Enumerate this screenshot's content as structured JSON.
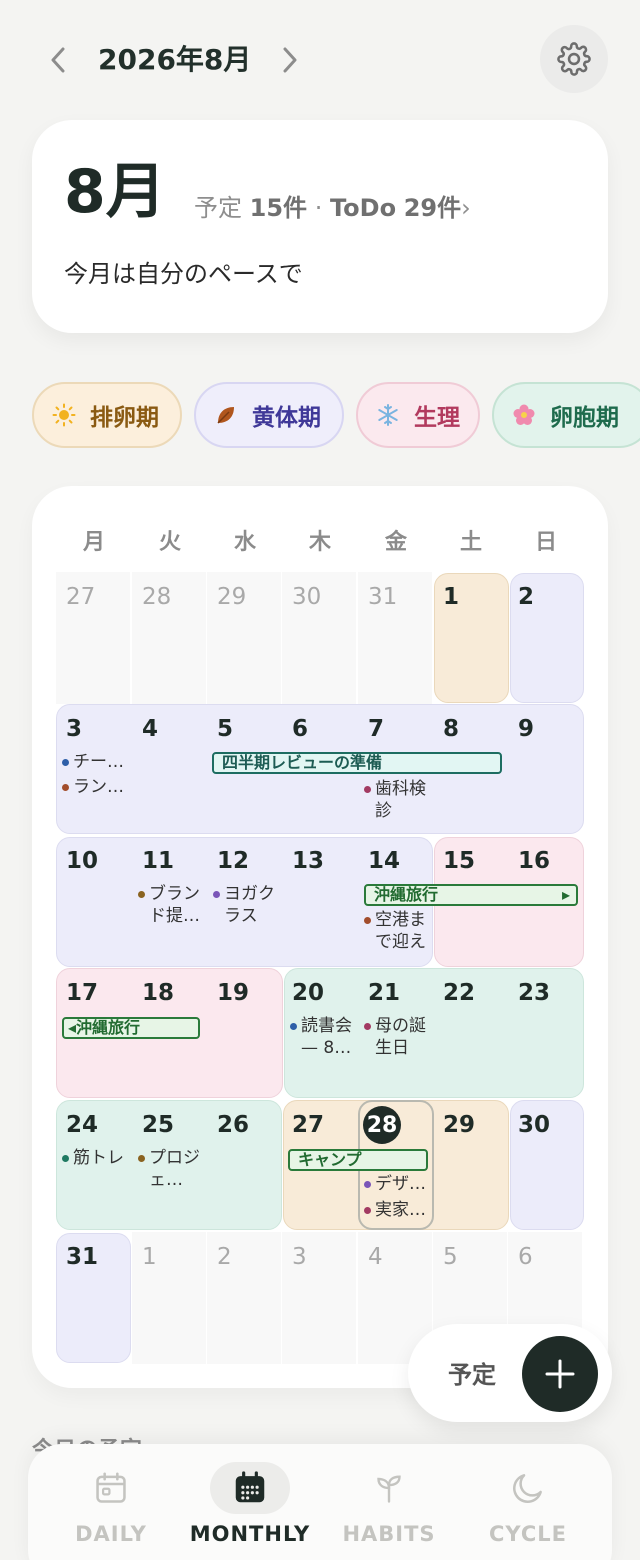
{
  "header": {
    "title": "2026年8月",
    "prev_icon": "chevron-left-icon",
    "next_icon": "chevron-right-icon",
    "settings_icon": "gear-icon"
  },
  "summary": {
    "month": "8月",
    "events_label": "予定",
    "events_count": "15件",
    "separator": "·",
    "todo_label": "ToDo",
    "todo_count": "29件",
    "arrow": "›",
    "message": "今月は自分のペースで"
  },
  "cycle_chips": [
    {
      "label": "排卵期",
      "icon": "sun-icon",
      "bg": "#fcefdc",
      "border": "#ecd9b8",
      "color": "#8a5a12"
    },
    {
      "label": "黄体期",
      "icon": "leaf-icon",
      "bg": "#efeefb",
      "border": "#d8d6f2",
      "color": "#3f3898"
    },
    {
      "label": "生理",
      "icon": "snowflake-icon",
      "bg": "#fbe9ee",
      "border": "#f0cbd6",
      "color": "#b23a5e"
    },
    {
      "label": "卵胞期",
      "icon": "flower-icon",
      "bg": "#e2f3ec",
      "border": "#c5e3d4",
      "color": "#1e6b4d"
    }
  ],
  "colors": {
    "ovulation": "#f8ebd8",
    "luteal": "#ececfa",
    "period": "#fbe8ee",
    "follicular": "#e0f2ec"
  },
  "weekdays": [
    "月",
    "火",
    "水",
    "木",
    "金",
    "土",
    "日"
  ],
  "weeks": [
    [
      "27",
      "28",
      "29",
      "30",
      "31",
      "1",
      "2"
    ],
    [
      "3",
      "4",
      "5",
      "6",
      "7",
      "8",
      "9"
    ],
    [
      "10",
      "11",
      "12",
      "13",
      "14",
      "15",
      "16"
    ],
    [
      "17",
      "18",
      "19",
      "20",
      "21",
      "22",
      "23"
    ],
    [
      "24",
      "25",
      "26",
      "27",
      "28",
      "29",
      "30"
    ],
    [
      "31",
      "1",
      "2",
      "3",
      "4",
      "5",
      "6"
    ]
  ],
  "events": {
    "w2_mon_1": "チー…",
    "w2_mon_2": "ラン…",
    "w2_fri": "歯科検診",
    "w3_tue": "ブランド提…",
    "w3_wed": "ヨガクラス",
    "w3_fri": "空港まで迎え",
    "w4_thu": "読書会 — 8…",
    "w4_fri": "母の誕生日",
    "w5_mon": "筋トレ",
    "w5_tue": "プロジェ…",
    "w5_fri_1": "デザ…",
    "w5_fri_2": "実家…"
  },
  "event_dot_colors": {
    "blue": "#2e5fa8",
    "brown": "#a24d2c",
    "plum": "#a23a62",
    "olive": "#8a6320",
    "purple": "#7a55b8",
    "teal": "#1f7a62"
  },
  "bars": {
    "review": "四半期レビューの準備",
    "trip_start": "沖縄旅行",
    "trip_start_arrow": "▸",
    "trip_cont_arrow": "◂",
    "trip_cont": "沖縄旅行",
    "camp": "キャンプ"
  },
  "add": {
    "label": "予定",
    "icon": "plus-icon"
  },
  "today_section": "今日の予定",
  "tabs": [
    {
      "label": "DAILY",
      "icon": "calendar-day-icon"
    },
    {
      "label": "MONTHLY",
      "icon": "calendar-grid-icon"
    },
    {
      "label": "HABITS",
      "icon": "sprout-icon"
    },
    {
      "label": "CYCLE",
      "icon": "moon-icon"
    }
  ]
}
